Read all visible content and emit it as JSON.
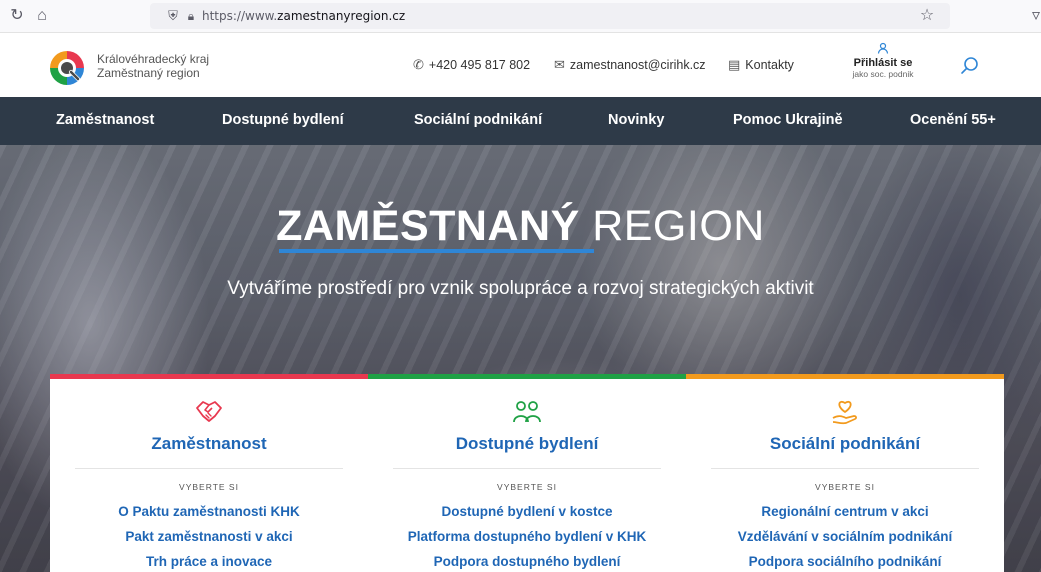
{
  "browser": {
    "url_prefix": "https://www.",
    "url_host": "zamestnanyregion.cz"
  },
  "header": {
    "logo_line1": "Královéhradecký kraj",
    "logo_line2": "Zaměstnaný region",
    "phone": "+420 495 817 802",
    "email": "zamestnanost@cirihk.cz",
    "contacts": "Kontakty",
    "login_title": "Přihlásit se",
    "login_sub": "jako soc. podnik"
  },
  "nav": {
    "items": [
      "Zaměstnanost",
      "Dostupné bydlení",
      "Sociální podnikání",
      "Novinky",
      "Pomoc Ukrajině",
      "Ocenění 55+"
    ]
  },
  "hero": {
    "title_bold": "ZAMĚSTNANÝ",
    "title_light": "REGION",
    "subtitle": "Vytváříme prostředí pro vznik spolupráce a rozvoj strategických aktivit"
  },
  "cards": [
    {
      "title": "Zaměstnanost",
      "select_label": "VYBERTE SI",
      "accent": "#e8384f",
      "icon": "handshake-icon",
      "links": [
        "O Paktu zaměstnanosti KHK",
        "Pakt zaměstnanosti v akci",
        "Trh práce a inovace"
      ]
    },
    {
      "title": "Dostupné bydlení",
      "select_label": "VYBERTE SI",
      "accent": "#1fa145",
      "icon": "people-icon",
      "links": [
        "Dostupné bydlení v kostce",
        "Platforma dostupného bydlení v KHK",
        "Podpora dostupného bydlení"
      ]
    },
    {
      "title": "Sociální podnikání",
      "select_label": "VYBERTE SI",
      "accent": "#f29a1d",
      "icon": "heart-hand-icon",
      "links": [
        "Regionální centrum v akci",
        "Vzdělávání v sociálním podnikání",
        "Podpora sociálního podnikání"
      ]
    }
  ]
}
